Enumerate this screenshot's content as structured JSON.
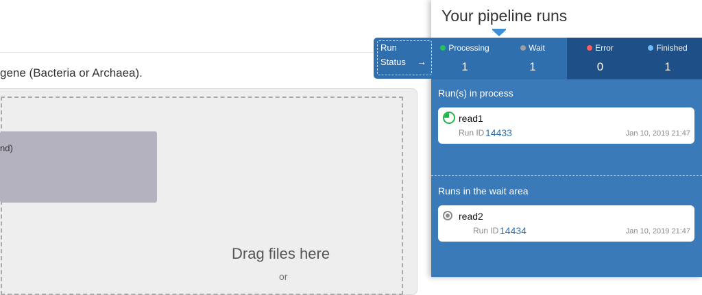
{
  "background": {
    "instruction": "gene (Bacteria or Archaea).",
    "file_card_text": "nd)",
    "drag_text": "Drag files here",
    "drag_sub": "or"
  },
  "panel": {
    "title": "Your pipeline runs",
    "status": {
      "processing": {
        "label": "Processing",
        "count": "1",
        "color": "#21c35a"
      },
      "wait": {
        "label": "Wait",
        "count": "1",
        "color": "#9e9e9e"
      },
      "error": {
        "label": "Error",
        "count": "0",
        "color": "#ff5b5b"
      },
      "finished": {
        "label": "Finished",
        "count": "1",
        "color": "#6cbcf7"
      }
    },
    "in_process_title": "Run(s) in process",
    "wait_area_title": "Runs in the wait area",
    "runs_in_process": [
      {
        "name": "read1",
        "run_id_label": "Run ID",
        "run_id": "14433",
        "date": "Jan 10, 2019 21:47",
        "icon": "processing-icon"
      }
    ],
    "runs_waiting": [
      {
        "name": "read2",
        "run_id_label": "Run ID",
        "run_id": "14434",
        "date": "Jan 10, 2019 21:47",
        "icon": "wait-icon"
      }
    ]
  },
  "run_status_tab": {
    "line1": "Run",
    "line2": "Status",
    "arrow": "→"
  }
}
